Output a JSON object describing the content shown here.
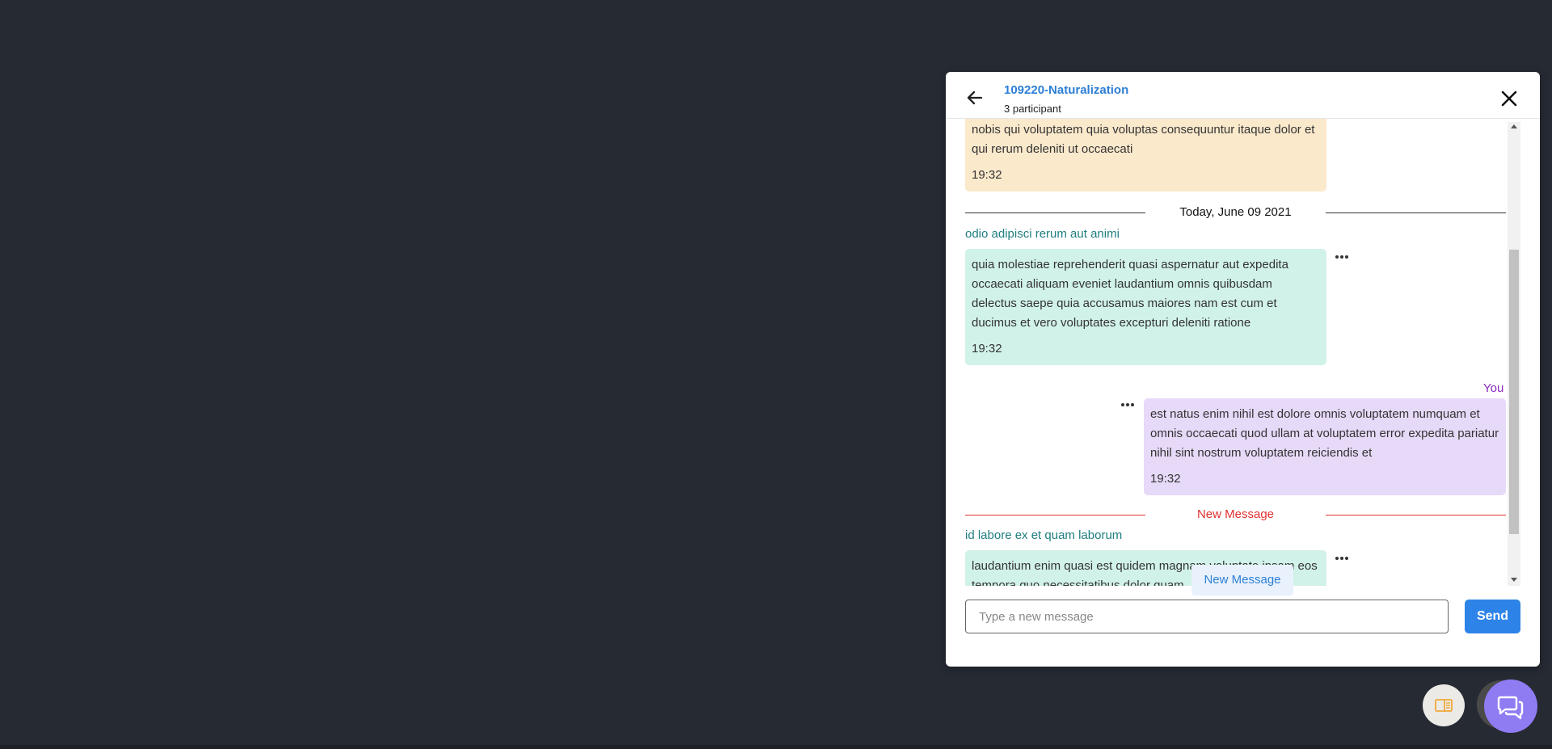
{
  "header": {
    "title": "109220-Naturalization",
    "participants": "3 participant"
  },
  "messages": {
    "first": {
      "text": "nobis qui voluptatem quia voluptas consequuntur itaque dolor et qui rerum deleniti ut occaecati",
      "time": "19:32"
    },
    "date_divider": "Today, June 09 2021",
    "second": {
      "sender": "odio adipisci rerum aut animi",
      "text": "quia molestiae reprehenderit quasi aspernatur aut expedita occaecati aliquam eveniet laudantium omnis quibusdam delectus saepe quia accusamus maiores nam est cum et ducimus et vero voluptates excepturi deleniti ratione",
      "time": "19:32"
    },
    "third": {
      "sender": "You",
      "text": "est natus enim nihil est dolore omnis voluptatem numquam et omnis occaecati quod ullam at voluptatem error expedita pariatur nihil sint nostrum voluptatem reiciendis et",
      "time": "19:32"
    },
    "new_divider": "New Message",
    "fourth": {
      "sender": "id labore ex et quam laborum",
      "text": "laudantium enim quasi est quidem magnam voluptate ipsam eos tempora quo necessitatibus dolor quam"
    }
  },
  "new_message_button": "New Message",
  "composer": {
    "placeholder": "Type a new message",
    "send_label": "Send"
  },
  "colors": {
    "background": "#262a33",
    "accent_blue": "#2d83e8",
    "you_purple": "#8a2ac0",
    "sender_teal": "#1f7e80",
    "new_message_red": "#e03131",
    "chat_fab": "#8f7cf3"
  },
  "icons": {
    "back": "arrow-left-icon",
    "close": "close-icon",
    "more": "more-dots-icon",
    "panel": "panel-toggle-icon",
    "chat": "chat-bubbles-icon"
  }
}
